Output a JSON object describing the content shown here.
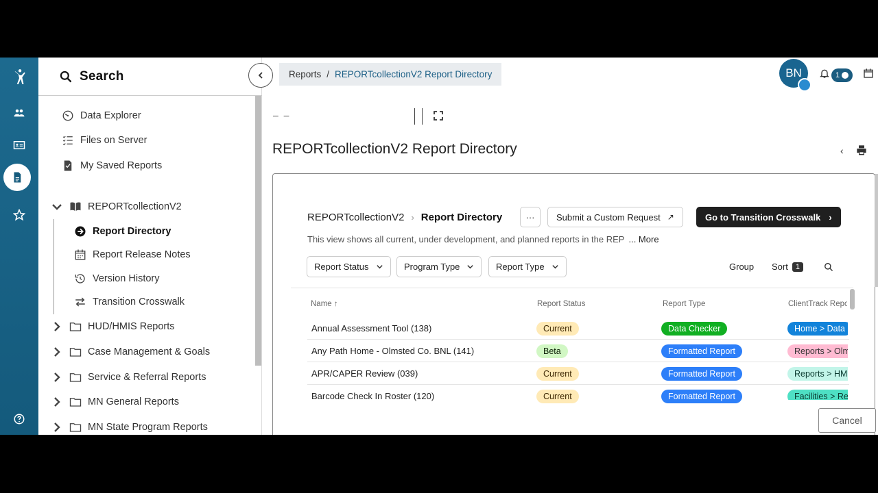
{
  "sidebar": {
    "search_label": "Search",
    "items": [
      {
        "label": "Data Explorer"
      },
      {
        "label": "Files on Server"
      },
      {
        "label": "My Saved Reports"
      }
    ],
    "collection": {
      "label": "REPORTcollectionV2"
    },
    "children": [
      {
        "label": "Report Directory"
      },
      {
        "label": "Report Release Notes"
      },
      {
        "label": "Version History"
      },
      {
        "label": "Transition Crosswalk"
      }
    ],
    "folders": [
      {
        "label": "HUD/HMIS Reports"
      },
      {
        "label": "Case Management & Goals"
      },
      {
        "label": "Service & Referral Reports"
      },
      {
        "label": "MN General Reports"
      },
      {
        "label": "MN State Program Reports"
      }
    ]
  },
  "header": {
    "breadcrumb_root": "Reports",
    "breadcrumb_sep": "/",
    "breadcrumb_current": "REPORTcollectionV2 Report Directory",
    "avatar_initials": "BN",
    "notification_count": "1"
  },
  "toolbar": {
    "dashes": "– –"
  },
  "page": {
    "title": "REPORTcollectionV2 Report Directory",
    "back": "‹"
  },
  "embed": {
    "crumb_root": "REPORTcollectionV2",
    "crumb_arrow": "›",
    "crumb_current": "Report Directory",
    "more_label": "···",
    "custom_request_label": "Submit a Custom Request",
    "external_glyph": "↗",
    "transition_label": "Go to Transition Crosswalk",
    "transition_glyph": "›",
    "description": "This view shows all current, under development, and planned reports in the REP",
    "description_more": "... More",
    "filters": [
      "Report Status",
      "Program Type",
      "Report Type"
    ],
    "group_label": "Group",
    "sort_label": "Sort",
    "sort_count": "1",
    "columns": [
      "Name ↑",
      "Report Status",
      "Report Type",
      "ClientTrack Repor"
    ],
    "rows": [
      {
        "name": "Annual Assessment Tool (138)",
        "status": "Current",
        "type": "Data Checker",
        "ct": "Home > Data"
      },
      {
        "name": "Any Path Home - Olmsted Co. BNL (141)",
        "status": "Beta",
        "type": "Formatted Report",
        "ct": "Reports > Olm"
      },
      {
        "name": "APR/CAPER Review (039)",
        "status": "Current",
        "type": "Formatted Report",
        "ct": "Reports > HM"
      },
      {
        "name": "Barcode Check In Roster (120)",
        "status": "Current",
        "type": "Formatted Report",
        "ct": "Facilities > Re"
      }
    ]
  },
  "footer": {
    "cancel_label": "Cancel"
  },
  "colors": {
    "rail": "#145a7c",
    "status_current_bg": "#ffeab6",
    "status_beta_bg": "#d1f7c4",
    "type_checker_bg": "#11af22",
    "type_formatted_bg": "#2d7ff9",
    "ct_home_bg": "#1283da",
    "ct_reports_olm_bg": "#ffbbd2",
    "ct_reports_hm_bg": "#c2f5e9",
    "ct_facilities_bg": "#4ee0c4"
  }
}
